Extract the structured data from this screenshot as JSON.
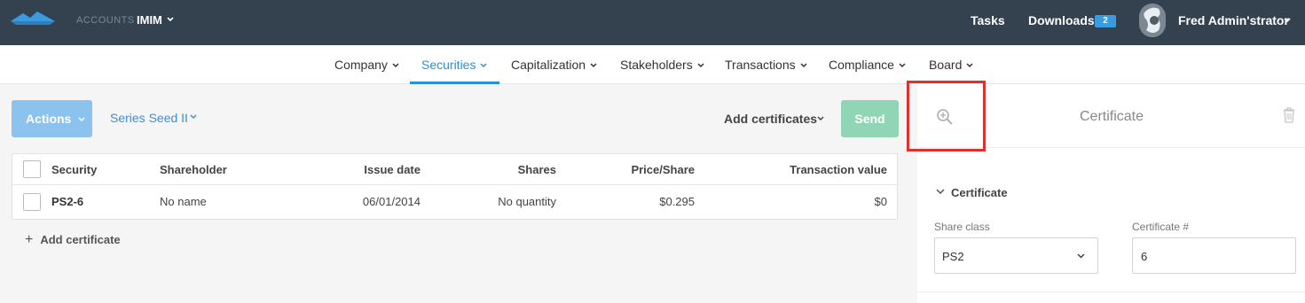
{
  "colors": {
    "topbar": "#34414e",
    "accent": "#2b8fd6",
    "actions_button": "#8cc3ee",
    "send_button": "#90d6b6",
    "highlight_box": "#e0302b",
    "badge": "#3a9be0"
  },
  "topbar": {
    "accounts_label": "ACCOUNTS",
    "account_name": "IMIM",
    "tasks_label": "Tasks",
    "downloads_label": "Downloads",
    "downloads_count": "2",
    "user_name": "Fred Admin'strator"
  },
  "nav": {
    "items": [
      {
        "label": "Company"
      },
      {
        "label": "Securities"
      },
      {
        "label": "Capitalization"
      },
      {
        "label": "Stakeholders"
      },
      {
        "label": "Transactions"
      },
      {
        "label": "Compliance"
      },
      {
        "label": "Board"
      }
    ],
    "active": "Securities"
  },
  "toolbar": {
    "actions_label": "Actions",
    "series_label": "Series Seed II",
    "add_certificates_label": "Add certificates",
    "send_label": "Send"
  },
  "table": {
    "columns": [
      "Security",
      "Shareholder",
      "Issue date",
      "Shares",
      "Price/Share",
      "Transaction value"
    ],
    "rows": [
      {
        "security": "PS2-6",
        "shareholder": "No name",
        "issue_date": "06/01/2014",
        "shares": "No quantity",
        "price_share": "$0.295",
        "transaction_value": "$0"
      }
    ]
  },
  "add_certificate_label": "Add certificate",
  "panel": {
    "title": "Certificate",
    "section_title": "Certificate",
    "share_class_label": "Share class",
    "share_class_value": "PS2",
    "certificate_number_label": "Certificate #",
    "certificate_number_value": "6"
  },
  "icons": [
    "logo-icon",
    "chevron-down-icon",
    "avatar",
    "zoom-in-icon",
    "trash-icon",
    "plus-icon"
  ]
}
